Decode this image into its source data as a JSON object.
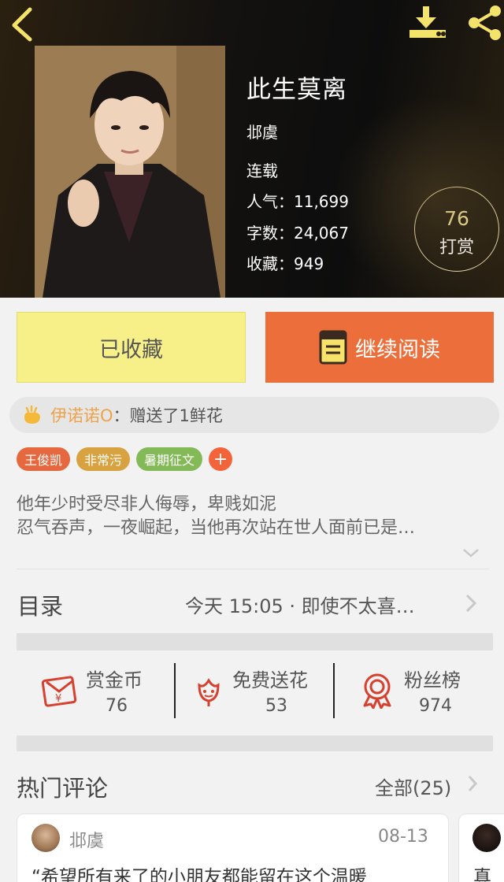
{
  "book": {
    "title": "此生莫离",
    "author": "邶虞",
    "status": "连载",
    "popularity_label": "人气：",
    "popularity": "11,699",
    "words_label": "字数：",
    "words": "24,067",
    "favorites_label": "收藏：",
    "favorites": "949",
    "reward_count": "76",
    "reward_label": "打赏"
  },
  "icons": {
    "back": "chevron-left-icon",
    "download": "download-icon",
    "share": "share-icon",
    "book": "book-icon",
    "gift": "gift-hand-icon",
    "red-envelope": "red-envelope-icon",
    "flower": "flower-icon",
    "medal": "medal-icon"
  },
  "buttons": {
    "collected": "已收藏",
    "continue_reading": "继续阅读"
  },
  "gift_notice": {
    "user": "伊诺诺O",
    "text": "：赠送了1鲜花"
  },
  "tags": [
    {
      "label": "王俊凯",
      "color": "#e5683e"
    },
    {
      "label": "非常污",
      "color": "#d7a23f"
    },
    {
      "label": "暑期征文",
      "color": "#84b958"
    }
  ],
  "tag_add": "+",
  "intro": {
    "line1": "他年少时受尽非人侮辱，卑贱如泥",
    "line2": "忍气吞声，一夜崛起，当他再次站在世人面前已是…"
  },
  "toc": {
    "title": "目录",
    "latest": "今天 15:05 · 即使不太喜…"
  },
  "actions": [
    {
      "label": "赏金币",
      "count": "76"
    },
    {
      "label": "免费送花",
      "count": "53"
    },
    {
      "label": "粉丝榜",
      "count": "974"
    }
  ],
  "comments": {
    "title": "热门评论",
    "all": "全部(25)",
    "items": [
      {
        "author": "邶虞",
        "date": "08-13",
        "text": "“希望所有来了的小朋友都能留在这个温暖"
      },
      {
        "text": "真"
      }
    ]
  },
  "colors": {
    "accent_orange": "#ec6f3b",
    "collected_yellow": "#f7f089",
    "gift_user": "#eda34a",
    "icon_red": "#d6402e",
    "header_text": "#ffffff"
  }
}
